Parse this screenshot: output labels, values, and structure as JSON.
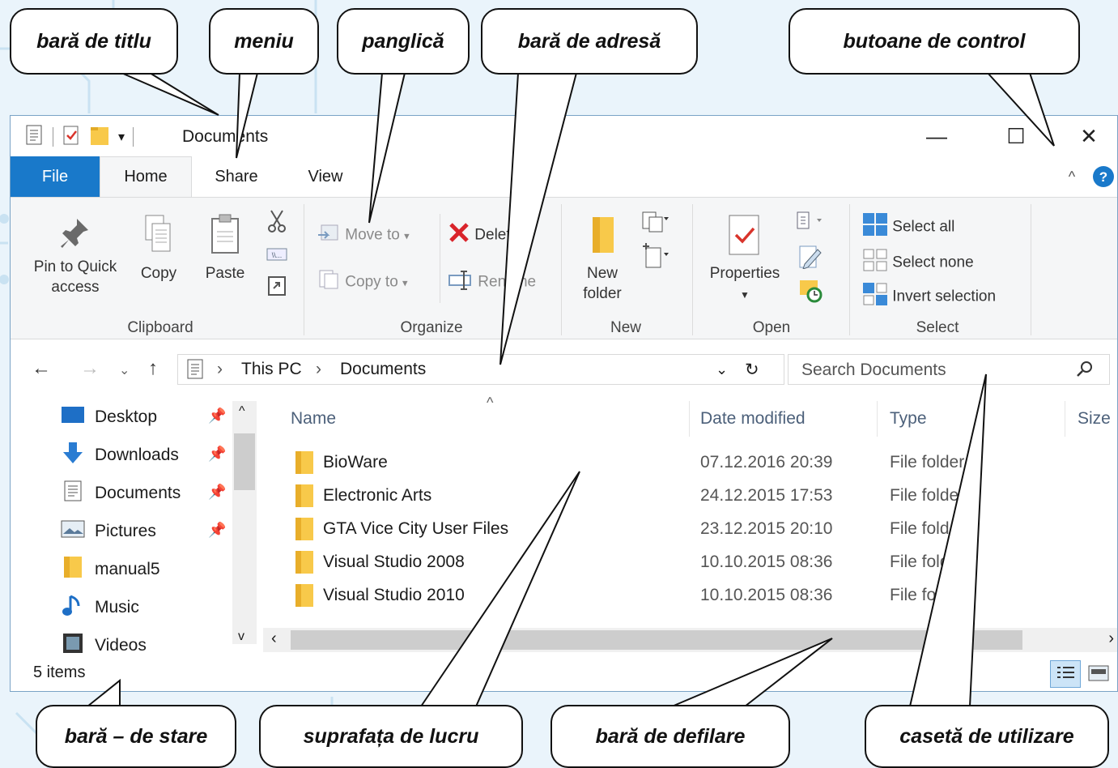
{
  "window": {
    "title": "Documents",
    "controls": {
      "minimize": "—",
      "maximize": "☐",
      "close": "✕"
    }
  },
  "tabs": [
    {
      "label": "File"
    },
    {
      "label": "Home"
    },
    {
      "label": "Share"
    },
    {
      "label": "View"
    }
  ],
  "ribbon": {
    "clipboard": {
      "pin_line1": "Pin to Quick",
      "pin_line2": "access",
      "copy": "Copy",
      "paste": "Paste",
      "label": "Clipboard"
    },
    "organize": {
      "move_to": "Move to",
      "copy_to": "Copy to",
      "delete": "Delete",
      "rename": "Rename",
      "label": "Organize"
    },
    "new": {
      "folder_line1": "New",
      "folder_line2": "folder",
      "label": "New"
    },
    "open": {
      "properties": "Properties",
      "label": "Open"
    },
    "select": {
      "select_all": "Select all",
      "select_none": "Select none",
      "invert": "Invert selection",
      "label": "Select"
    }
  },
  "address": {
    "crumbs": [
      "This PC",
      "Documents"
    ],
    "search_placeholder": "Search Documents"
  },
  "nav_items": [
    {
      "label": "Desktop",
      "icon": "desktop-icon",
      "pinned": true
    },
    {
      "label": "Downloads",
      "icon": "downloads-icon",
      "pinned": true
    },
    {
      "label": "Documents",
      "icon": "documents-icon",
      "pinned": true
    },
    {
      "label": "Pictures",
      "icon": "pictures-icon",
      "pinned": true
    },
    {
      "label": "manual5",
      "icon": "folder-icon",
      "pinned": false
    },
    {
      "label": "Music",
      "icon": "music-icon",
      "pinned": false
    },
    {
      "label": "Videos",
      "icon": "videos-icon",
      "pinned": false
    }
  ],
  "columns": {
    "name": "Name",
    "date": "Date modified",
    "type": "Type",
    "size": "Size"
  },
  "files": [
    {
      "name": "BioWare",
      "date": "07.12.2016 20:39",
      "type": "File folder"
    },
    {
      "name": "Electronic Arts",
      "date": "24.12.2015 17:53",
      "type": "File folder"
    },
    {
      "name": "GTA Vice City User Files",
      "date": "23.12.2015 20:10",
      "type": "File folder"
    },
    {
      "name": "Visual Studio 2008",
      "date": "10.10.2015 08:36",
      "type": "File folder"
    },
    {
      "name": "Visual Studio 2010",
      "date": "10.10.2015 08:36",
      "type": "File folder"
    }
  ],
  "status": {
    "items": "5 items"
  },
  "callouts": {
    "title_bar": "bară de titlu",
    "menu": "meniu",
    "ribbon": "panglică",
    "address_bar": "bară de adresă",
    "control_buttons": "butoane de control",
    "status_bar": "bară – de stare",
    "workspace": "suprafața de lucru",
    "scroll_bar": "bară de defilare",
    "search_box": "casetă de utilizare"
  },
  "colors": {
    "accent": "#1979ca",
    "folder": "#f8c94a",
    "background": "#eaf4fb"
  }
}
